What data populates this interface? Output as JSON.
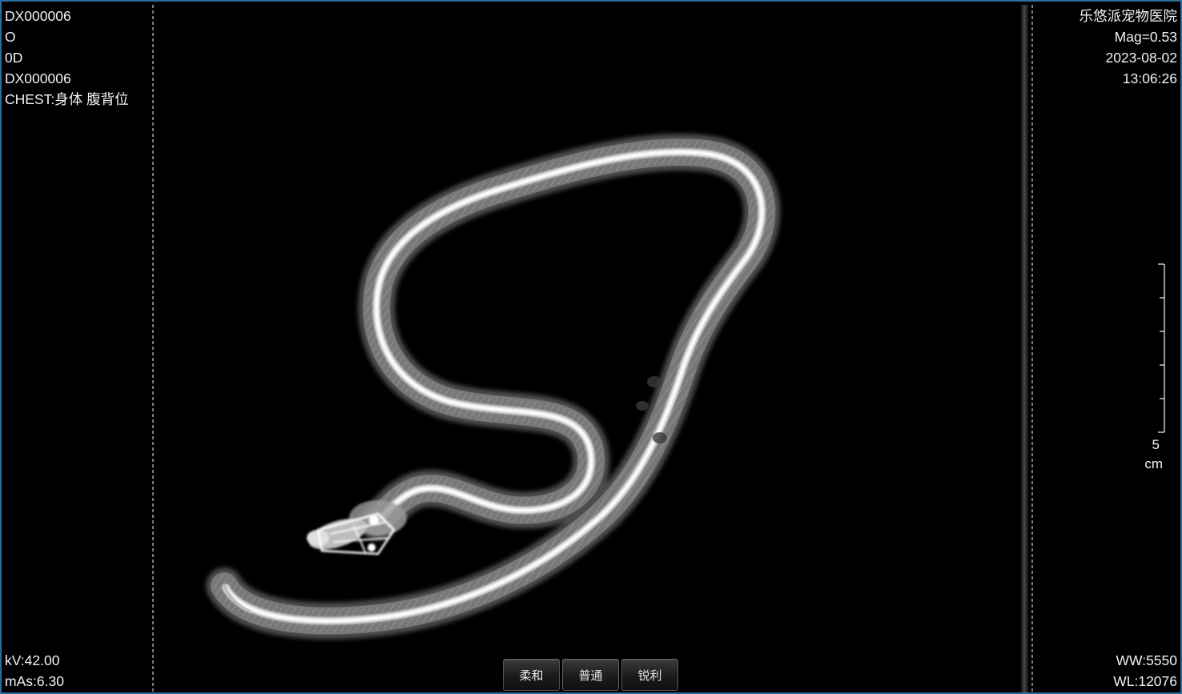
{
  "window": {
    "accent_border_color": "#2a6d9a"
  },
  "overlay": {
    "top_left": {
      "patient_id": "DX000006",
      "line2": "O",
      "line3": "0D",
      "study_id": "DX000006",
      "body_part": "CHEST:身体 腹背位"
    },
    "top_right": {
      "institution": "乐悠派宠物医院",
      "magnification": "Mag=0.53",
      "date": "2023-08-02",
      "time": "13:06:26"
    },
    "bottom_left": {
      "kv": "kV:42.00",
      "mas": "mAs:6.30"
    },
    "bottom_right": {
      "window_width": "WW:5550",
      "window_level": "WL:12076"
    },
    "scale": {
      "value": "5",
      "unit": "cm"
    }
  },
  "filter_buttons": [
    {
      "label": "柔和"
    },
    {
      "label": "普通"
    },
    {
      "label": "锐利"
    }
  ],
  "image": {
    "subject_icon": "snake-xray-image"
  }
}
